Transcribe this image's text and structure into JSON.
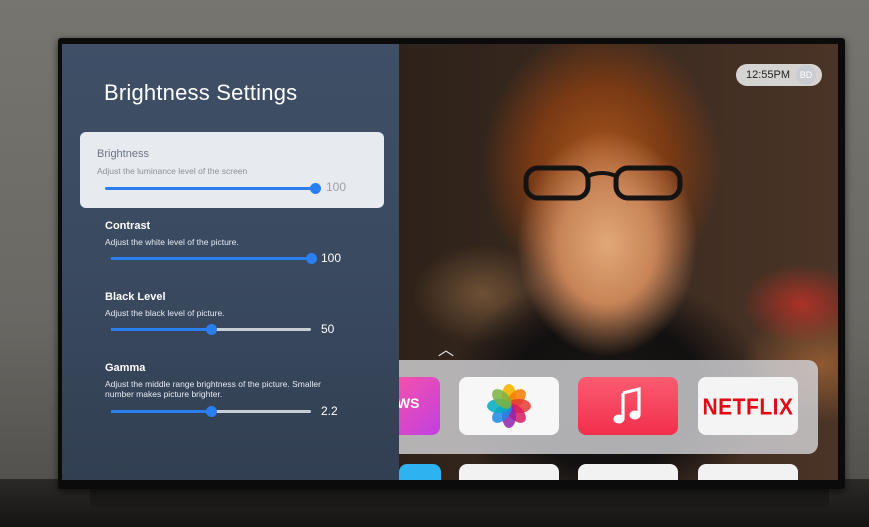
{
  "panel": {
    "title": "Brightness Settings",
    "settings": [
      {
        "name": "Brightness",
        "description": "Adjust the luminance level of the screen",
        "value": "100",
        "level": 1.0,
        "focused": true
      },
      {
        "name": "Contrast",
        "description": "Adjust the white level of the picture.",
        "value": "100",
        "level": 1.0,
        "focused": false
      },
      {
        "name": "Black Level",
        "description": "Adjust the black level of picture.",
        "value": "50",
        "level": 0.5,
        "focused": false
      },
      {
        "name": "Gamma",
        "description": "Adjust the middle range brightness of the picture. Smaller number makes picture brighter.",
        "value": "2.2",
        "level": 0.5,
        "focused": false
      }
    ]
  },
  "status": {
    "time": "12:55PM",
    "profile_initials": "BD"
  },
  "app_shelf": {
    "apps": [
      {
        "name": "tv-shows",
        "label": "OWS",
        "sublabel": "s"
      },
      {
        "name": "photos",
        "icon": "photos-flower-icon"
      },
      {
        "name": "music",
        "icon": "music-note-icon"
      },
      {
        "name": "netflix",
        "label": "NETFLIX"
      }
    ]
  },
  "colors": {
    "panel": "#3a4a60",
    "slider_accent": "#2a7ff0",
    "netflix_red": "#e30914",
    "music_red": "#f22f4b"
  }
}
